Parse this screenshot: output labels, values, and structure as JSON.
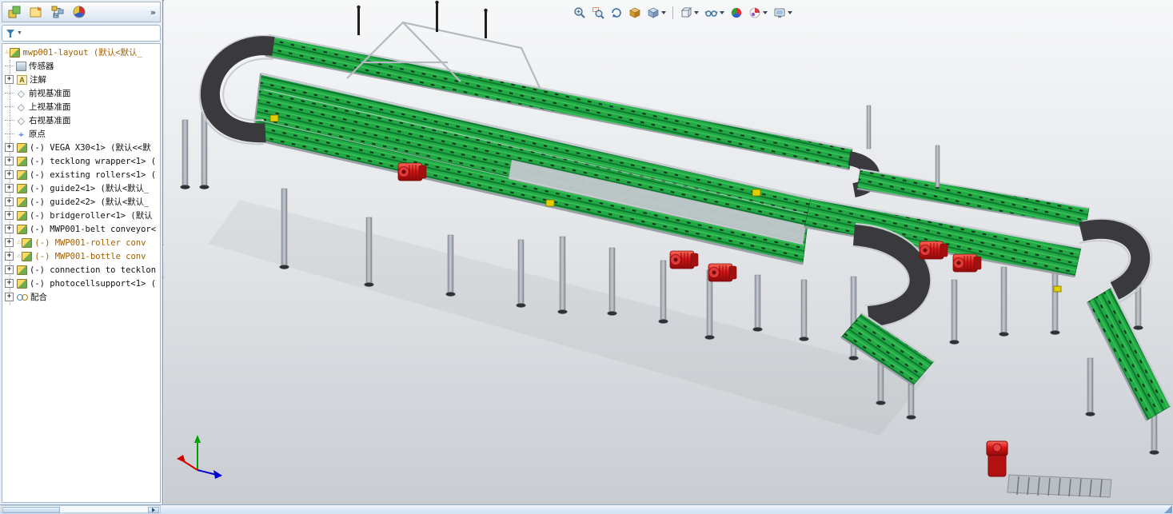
{
  "panel": {
    "tabs": [
      "featuremanager",
      "propertymanager",
      "configurationmanager",
      "displaymanager"
    ],
    "tree": {
      "items": [
        {
          "label": "mwp001-layout (默认<默认_",
          "icon": "assembly",
          "warning": true,
          "orange": true
        },
        {
          "label": "传感器",
          "icon": "sensor"
        },
        {
          "label": "注解",
          "icon": "annotation",
          "expandable": true
        },
        {
          "label": "前视基准面",
          "icon": "plane"
        },
        {
          "label": "上视基准面",
          "icon": "plane"
        },
        {
          "label": "右视基准面",
          "icon": "plane"
        },
        {
          "label": "原点",
          "icon": "origin"
        },
        {
          "label": "(-) VEGA X30<1> (默认<<默",
          "icon": "component",
          "expandable": true
        },
        {
          "label": "(-) tecklong wrapper<1> (",
          "icon": "component",
          "expandable": true
        },
        {
          "label": "(-) existing rollers<1> (",
          "icon": "component",
          "expandable": true
        },
        {
          "label": "(-) guide2<1> (默认<默认_",
          "icon": "component",
          "expandable": true
        },
        {
          "label": "(-) guide2<2> (默认<默认_",
          "icon": "component",
          "expandable": true
        },
        {
          "label": "(-) bridgeroller<1> (默认",
          "icon": "component",
          "expandable": true
        },
        {
          "label": "(-) MWP001-belt conveyor<",
          "icon": "component",
          "expandable": true
        },
        {
          "label": "(-) MWP001-roller conv",
          "icon": "component",
          "expandable": true,
          "warning": true,
          "orange": true
        },
        {
          "label": "(-) MWP001-bottle conv",
          "icon": "component",
          "expandable": true,
          "warning": true,
          "orange": true
        },
        {
          "label": "(-) connection to tecklon",
          "icon": "component",
          "expandable": true
        },
        {
          "label": "(-) photocellsupport<1> (",
          "icon": "component",
          "expandable": true
        },
        {
          "label": "配合",
          "icon": "mates",
          "expandable": true
        }
      ]
    }
  },
  "view_toolbar": {
    "icons": [
      "zoom-in-out",
      "zoom-to-area",
      "rotate-view",
      "view-orientation",
      "standard-views",
      "display-style",
      "hide-show-items",
      "edit-appearance",
      "apply-scene",
      "view-settings"
    ]
  },
  "icons": {
    "plus": "+",
    "warning": "⚠",
    "caret": "▼",
    "plane": "◇",
    "origin": "⌖",
    "annotation": "A",
    "overflow": "»"
  },
  "scene": {
    "components": [
      "belt-conveyor-loop",
      "roller-conveyor-array",
      "curve-belt-sections",
      "gear-motors",
      "support-legs",
      "truss-frame",
      "photocell-sensors",
      "descending-roller-conveyors",
      "orientation-triad"
    ]
  },
  "colors": {
    "roller_green": "#22a845",
    "roller_green_dark": "#0c7a2e",
    "belt_curve_dark": "#3a3a3c",
    "frame_gray": "#b8bdc3",
    "leg_gray": "#a7adb5",
    "motor_red": "#d41414",
    "sensor_yellow": "#e3cf00",
    "tree_warning_text": "#a05f00",
    "viewport_top": "#f7f8f9",
    "viewport_bottom": "#c9cdd2"
  }
}
